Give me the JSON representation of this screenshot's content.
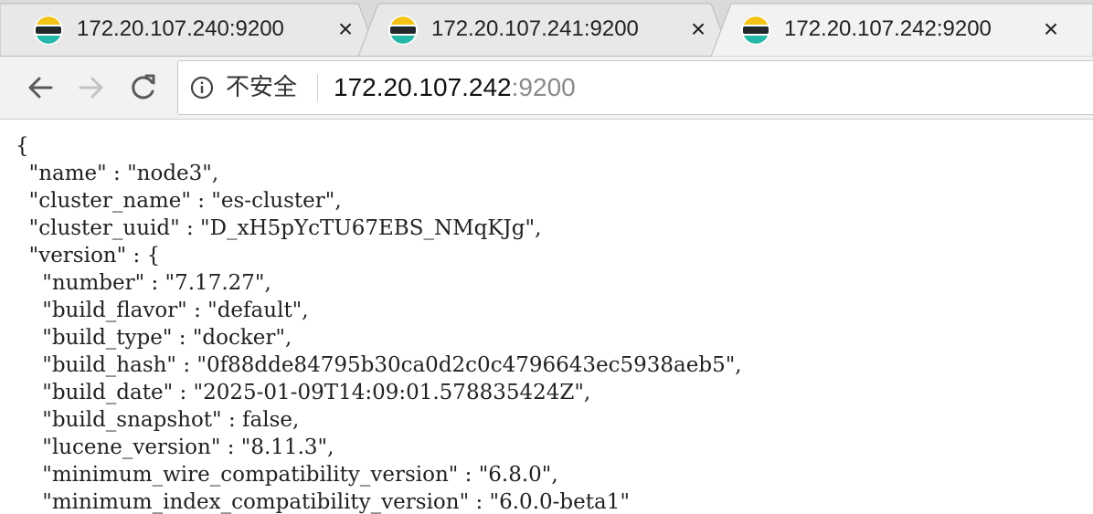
{
  "tabs": [
    {
      "title": "172.20.107.240:9200",
      "close": "×",
      "active": false
    },
    {
      "title": "172.20.107.241:9200",
      "close": "×",
      "active": false
    },
    {
      "title": "172.20.107.242:9200",
      "close": "×",
      "active": true
    }
  ],
  "toolbar": {
    "back_icon": "arrow-left-icon",
    "forward_icon": "arrow-right-icon",
    "reload_icon": "reload-icon",
    "security_icon": "info-circle-icon",
    "security_label": "不安全",
    "url_host": "172.20.107.242",
    "url_port": ":9200"
  },
  "colors": {
    "tabstrip_bg": "#dadada",
    "active_tab_bg": "#f2f2f2",
    "elastic_teal": "#25b7a8",
    "elastic_yellow": "#f3c316",
    "elastic_dark": "#23282d"
  },
  "json_lines": [
    "{",
    "  \"name\" : \"node3\",",
    "  \"cluster_name\" : \"es-cluster\",",
    "  \"cluster_uuid\" : \"D_xH5pYcTU67EBS_NMqKJg\",",
    "  \"version\" : {",
    "    \"number\" : \"7.17.27\",",
    "    \"build_flavor\" : \"default\",",
    "    \"build_type\" : \"docker\",",
    "    \"build_hash\" : \"0f88dde84795b30ca0d2c0c4796643ec5938aeb5\",",
    "    \"build_date\" : \"2025-01-09T14:09:01.578835424Z\",",
    "    \"build_snapshot\" : false,",
    "    \"lucene_version\" : \"8.11.3\",",
    "    \"minimum_wire_compatibility_version\" : \"6.8.0\",",
    "    \"minimum_index_compatibility_version\" : \"6.0.0-beta1\""
  ]
}
